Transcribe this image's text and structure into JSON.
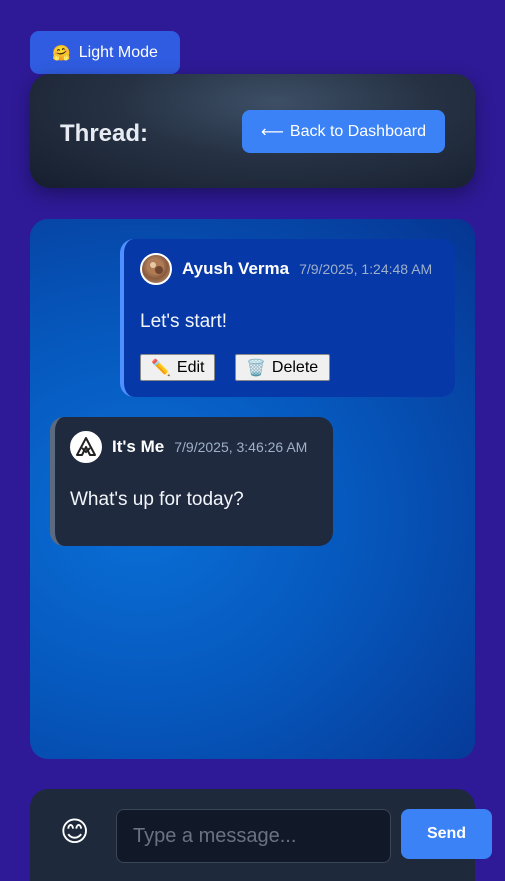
{
  "theme_toggle": {
    "icon": "hugging-face-emoji",
    "glyph": "🤗",
    "label": "Light Mode"
  },
  "header": {
    "title": "Thread:",
    "back_button": {
      "icon": "left-arrow-icon",
      "glyph": "⟵",
      "label": "Back to Dashboard"
    }
  },
  "messages": [
    {
      "author": "Ayush Verma",
      "timestamp": "7/9/2025, 1:24:48 AM",
      "text": "Let's start!",
      "own": true,
      "actions": [
        {
          "icon": "pencil-icon",
          "glyph": "✏️",
          "label": "Edit"
        },
        {
          "icon": "wastebasket-icon",
          "glyph": "🗑️",
          "label": "Delete"
        }
      ]
    },
    {
      "author": "It's Me",
      "timestamp": "7/9/2025, 3:46:26 AM",
      "text": "What's up for today?",
      "own": false
    }
  ],
  "composer": {
    "emoji_icon": "smiling-face-icon",
    "emoji_glyph": "😊",
    "placeholder": "Type a message...",
    "value": "",
    "send_label": "Send"
  },
  "colors": {
    "page_bg": "#2e1a96",
    "accent": "#3b82f6",
    "own_bubble": "#0638a8",
    "other_bubble": "#1f2a3e"
  }
}
